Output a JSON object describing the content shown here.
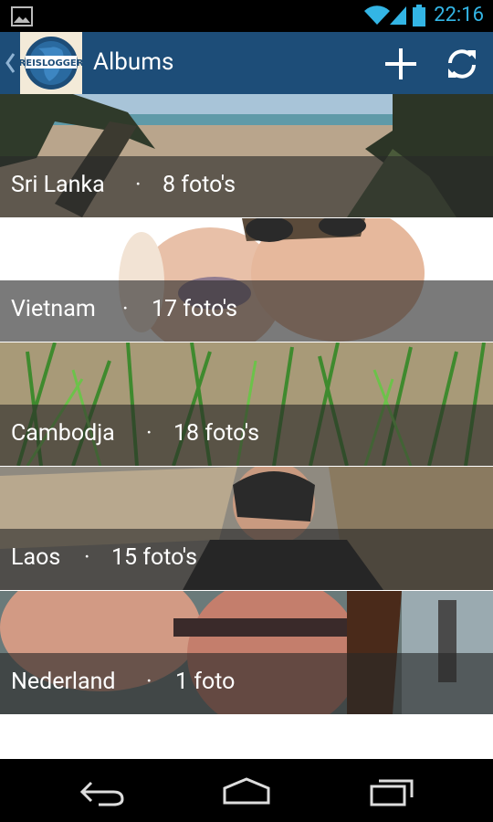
{
  "status_bar": {
    "time": "22:16",
    "icons": [
      "image-notification-icon",
      "wifi-icon",
      "signal-icon",
      "battery-icon"
    ]
  },
  "action_bar": {
    "title": "Albums",
    "logo_text": "REISLOGGER",
    "actions": [
      "add-icon",
      "refresh-icon"
    ]
  },
  "albums": [
    {
      "name": "Sri Lanka",
      "separator": "·",
      "count": "8 foto's"
    },
    {
      "name": "Vietnam",
      "separator": "·",
      "count": "17 foto's"
    },
    {
      "name": "Cambodja",
      "separator": "·",
      "count": "18 foto's"
    },
    {
      "name": "Laos",
      "separator": "·",
      "count": "15 foto's"
    },
    {
      "name": "Nederland",
      "separator": "·",
      "count": "1 foto"
    }
  ],
  "nav_bar": {
    "buttons": [
      "back-icon",
      "home-icon",
      "recent-apps-icon"
    ]
  },
  "colors": {
    "action_bar": "#1d4d78",
    "status_accent": "#33b5e5"
  }
}
